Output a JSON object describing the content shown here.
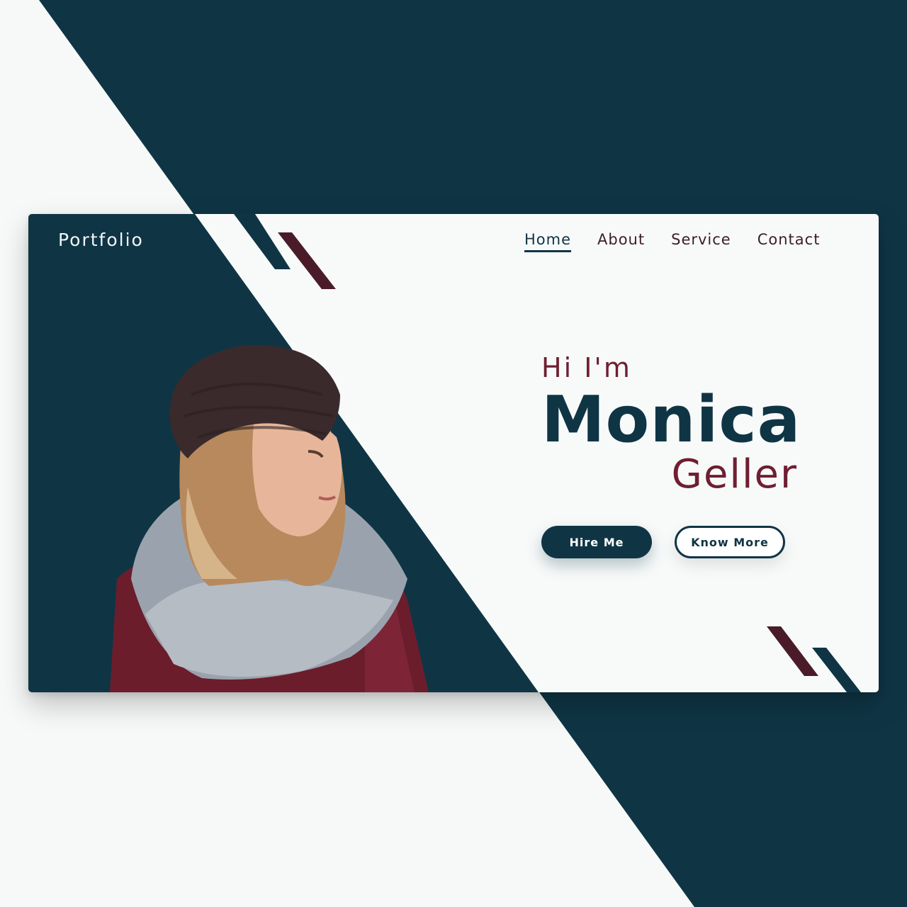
{
  "colors": {
    "navy": "#0f3545",
    "maroon": "#6e1f31",
    "background": "#f7f9f9"
  },
  "logo": "Portfolio",
  "nav": {
    "items": [
      {
        "label": "Home",
        "active": true
      },
      {
        "label": "About",
        "active": false
      },
      {
        "label": "Service",
        "active": false
      },
      {
        "label": "Contact",
        "active": false
      }
    ]
  },
  "hero": {
    "greeting": "Hi  I'm",
    "first_name": "Monica",
    "last_name": "Geller",
    "primary_button": "Hire Me",
    "secondary_button": "Know More"
  },
  "photo": {
    "subject": "woman in knit beanie and scarf"
  }
}
